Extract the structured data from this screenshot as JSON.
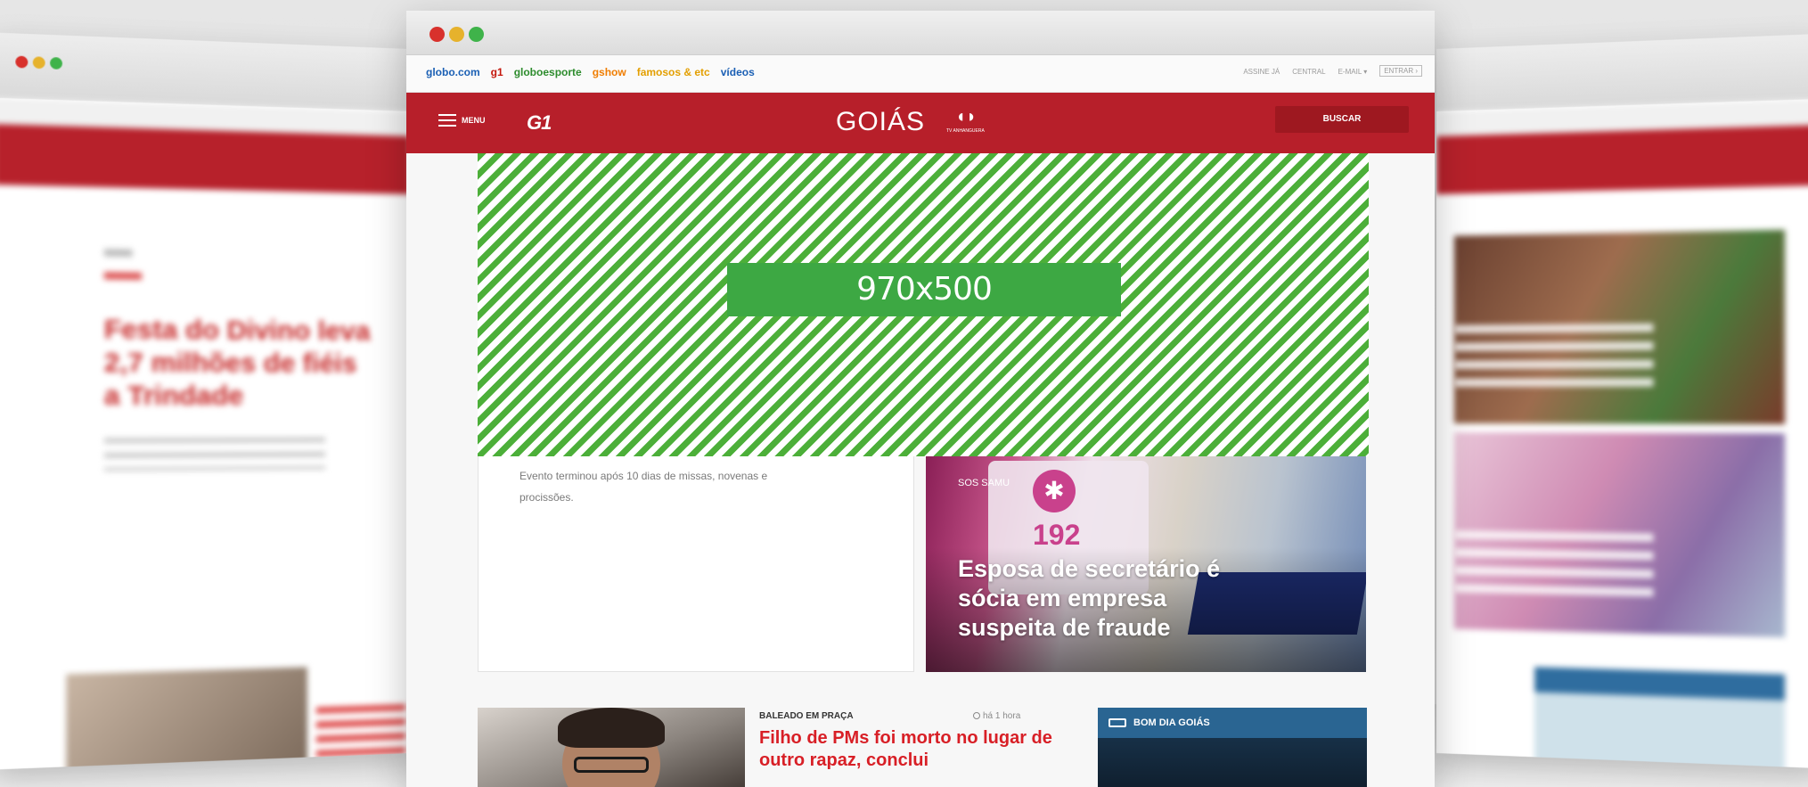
{
  "colors": {
    "brand_red": "#b71f2a",
    "ad_green": "#3da843",
    "headline_red": "#d81f26",
    "bdg_blue": "#2a6592"
  },
  "globo_nav": {
    "links": [
      {
        "label": "globo.com",
        "color": "#1a5fb4"
      },
      {
        "label": "g1",
        "color": "#c4170c"
      },
      {
        "label": "globoesporte",
        "color": "#2d8c2d"
      },
      {
        "label": "gshow",
        "color": "#f07d00"
      },
      {
        "label": "famosos & etc",
        "color": "#e39f00"
      },
      {
        "label": "vídeos",
        "color": "#1a5fb4"
      }
    ],
    "right_items": [
      "ASSINE JÁ",
      "CENTRAL",
      "E-MAIL ▾",
      "ENTRAR ›"
    ]
  },
  "header": {
    "menu_label": "MENU",
    "g1_logo": "G1",
    "region": "GOIÁS",
    "tv_logo_text": "TV ANHANGUERA",
    "search_label": "BUSCAR"
  },
  "ad": {
    "label": "970x500"
  },
  "story_left": {
    "summary": "Evento terminou após 10 dias de missas, novenas e procissões."
  },
  "story_right": {
    "kicker": "SOS SAMU",
    "title": "Esposa de secretário é sócia em empresa suspeita de fraude",
    "image_text": "192"
  },
  "story_lower": {
    "kicker": "BALEADO EM PRAÇA",
    "time": "há 1 hora",
    "title": "Filho de PMs foi morto no lugar de outro rapaz, conclui"
  },
  "video_box": {
    "title": "BOM DIA GOIÁS"
  },
  "side_left": {
    "headline": "Festa do Divino leva 2,7 milhões de fiéis a Trindade"
  }
}
